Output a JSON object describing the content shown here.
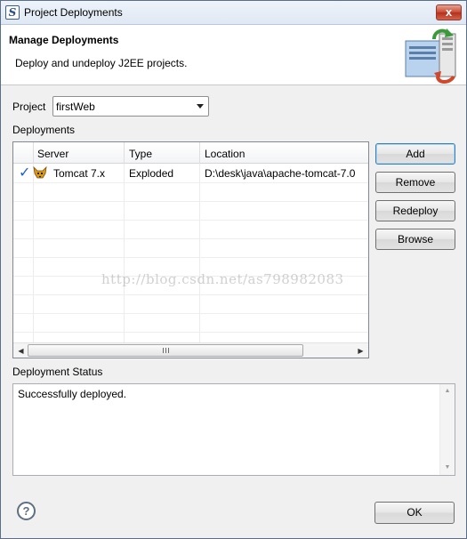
{
  "window": {
    "title": "Project Deployments",
    "close_glyph": "x"
  },
  "banner": {
    "title": "Manage Deployments",
    "description": "Deploy and undeploy J2EE projects."
  },
  "project": {
    "label": "Project",
    "selected": "firstWeb"
  },
  "deployments": {
    "label": "Deployments",
    "columns": [
      "Server",
      "Type",
      "Location"
    ],
    "rows": [
      {
        "server": "Tomcat  7.x",
        "type": "Exploded",
        "location": "D:\\desk\\java\\apache-tomcat-7.0",
        "checked": true
      }
    ]
  },
  "actions": {
    "add": "Add",
    "remove": "Remove",
    "redeploy": "Redeploy",
    "browse": "Browse"
  },
  "status": {
    "label": "Deployment Status",
    "text": "Successfully deployed."
  },
  "footer": {
    "ok": "OK",
    "help": "?"
  },
  "watermark": "http://blog.csdn.net/as798982083",
  "icons": {
    "row_check": "checkmark-icon",
    "row_server": "tomcat-icon",
    "app": "eclipse-icon"
  },
  "colors": {
    "accent": "#1f5fd3",
    "close": "#c9472f"
  }
}
